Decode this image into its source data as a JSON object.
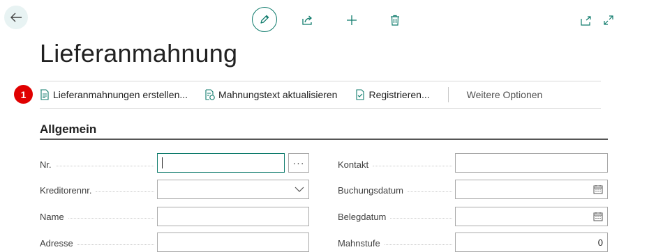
{
  "page": {
    "title": "Lieferanmahnung"
  },
  "actions": {
    "create_reminders": "Lieferanmahnungen erstellen...",
    "update_text": "Mahnungstext aktualisieren",
    "register": "Registrieren...",
    "more_options": "Weitere Optionen",
    "badge": "1"
  },
  "section": {
    "title": "Allgemein"
  },
  "fields": {
    "nr": {
      "label": "Nr.",
      "value": "",
      "lookup": "···"
    },
    "vendor_no": {
      "label": "Kreditorennr.",
      "value": ""
    },
    "name": {
      "label": "Name",
      "value": ""
    },
    "address": {
      "label": "Adresse",
      "value": ""
    },
    "contact": {
      "label": "Kontakt",
      "value": ""
    },
    "posting_date": {
      "label": "Buchungsdatum",
      "value": ""
    },
    "document_date": {
      "label": "Belegdatum",
      "value": ""
    },
    "reminder_level": {
      "label": "Mahnstufe",
      "value": "0"
    }
  },
  "colors": {
    "accent": "#0f7b6c",
    "badge": "#e00000"
  },
  "icons": [
    "back-arrow-icon",
    "pencil-icon",
    "share-icon",
    "plus-icon",
    "trash-icon",
    "open-new-window-icon",
    "expand-icon",
    "calendar-icon",
    "chevron-down-icon"
  ]
}
